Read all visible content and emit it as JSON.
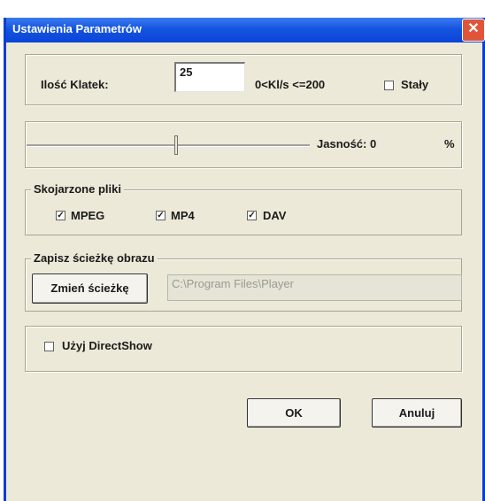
{
  "window": {
    "title": "Ustawienia Parametrów",
    "close_symbol": "✕"
  },
  "frames": {
    "label": "Ilość Klatek:",
    "value": "25",
    "range_text": "0<Kl/s  <=200",
    "fixed_label": "Stały",
    "fixed_checked": false
  },
  "brightness": {
    "label": "Jasność: 0",
    "unit": "%",
    "slider_fraction": 0.5
  },
  "associated_files": {
    "title": "Skojarzone pliki",
    "items": [
      {
        "label": "MPEG",
        "checked": true
      },
      {
        "label": "MP4",
        "checked": true
      },
      {
        "label": "DAV",
        "checked": true
      }
    ]
  },
  "save_path": {
    "title": "Zapisz ścieżkę obrazu",
    "change_button": "Zmień ścieżkę",
    "path_value": "C:\\Program Files\\Player"
  },
  "directshow": {
    "label": "Użyj DirectShow",
    "checked": false
  },
  "buttons": {
    "ok": "OK",
    "cancel": "Anuluj"
  },
  "icons": {
    "check_mark": "✓",
    "close": "close-icon"
  }
}
